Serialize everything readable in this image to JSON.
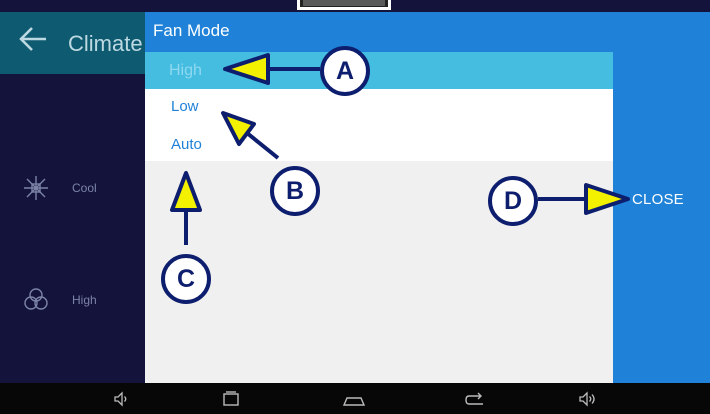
{
  "screen": {
    "header_title": "Climate",
    "side_items": [
      {
        "label": "Cool",
        "icon": "cooling-icon"
      },
      {
        "label": "High",
        "icon": "fan-icon"
      }
    ]
  },
  "dialog": {
    "title": "Fan Mode",
    "options": [
      {
        "label": "High",
        "selected": true
      },
      {
        "label": "Low",
        "selected": false
      },
      {
        "label": "Auto",
        "selected": false
      }
    ]
  },
  "right_panel": {
    "close_label": "CLOSE"
  },
  "callouts": [
    "A",
    "B",
    "C",
    "D"
  ],
  "nav": [
    "volume-down-icon",
    "recent-apps-icon",
    "home-icon",
    "back-icon",
    "volume-up-icon"
  ],
  "colors": {
    "accent": "#1f82d8",
    "selected": "#44bde0",
    "callout": "#0e1e6e",
    "arrow_fill": "#f3f000"
  }
}
